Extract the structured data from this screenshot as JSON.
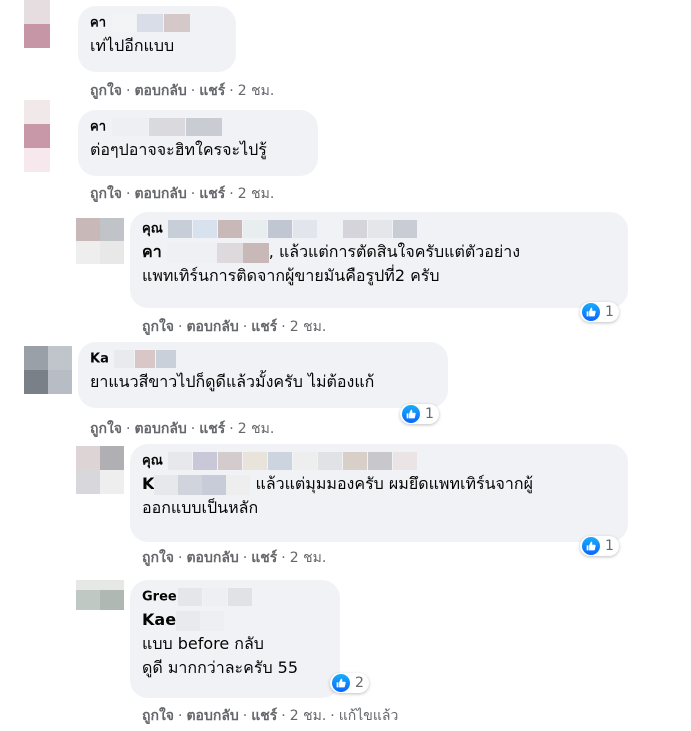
{
  "action_labels": {
    "like": "ถูกใจ",
    "reply": "ตอบกลับ",
    "share": "แชร์",
    "edited": "แก้ไขแล้ว"
  },
  "colors": {
    "bubble": "#f0f2f5",
    "meta": "#65676b",
    "like_blue": "#0866ff"
  },
  "comments": [
    {
      "name": "คา",
      "text": "เท่ไปอีกแบบ",
      "time": "2 ชม."
    },
    {
      "name": "คา",
      "text": "ต่อๆปอาจจะฮิทใครจะไปรู้",
      "time": "2 ชม."
    },
    {
      "name": "คุณ",
      "mention": "คา",
      "text_line1": ", แล้วแต่การตัดสินใจครับแต่ตัวอย่าง",
      "text_line2": "แพทเทิร์นการติดจากผู้ขายมันคือรูปที่2 ครับ",
      "time": "2 ชม.",
      "reactions": "1"
    },
    {
      "name": "Ka",
      "text": "ยาแนวสีขาวไปก็ดูดีแล้วมั้งครับ ไม่ต้องแก้",
      "time": "2 ชม.",
      "reactions": "1"
    },
    {
      "name": "คุณ",
      "mention": "K",
      "text_line1": "แล้วแต่มุมมองครับ ผมยึดแพทเทิร์นจากผู้",
      "text_line2": "ออกแบบเป็นหลัก",
      "time": "2 ชม.",
      "reactions": "1"
    },
    {
      "name": "Gree",
      "mention": "Kae",
      "text_line1": "แบบ before กลับ",
      "text_line2": "ดูดี มากกว่าละครับ 55",
      "time": "2 ชม.",
      "reactions": "2",
      "edited": true
    }
  ]
}
